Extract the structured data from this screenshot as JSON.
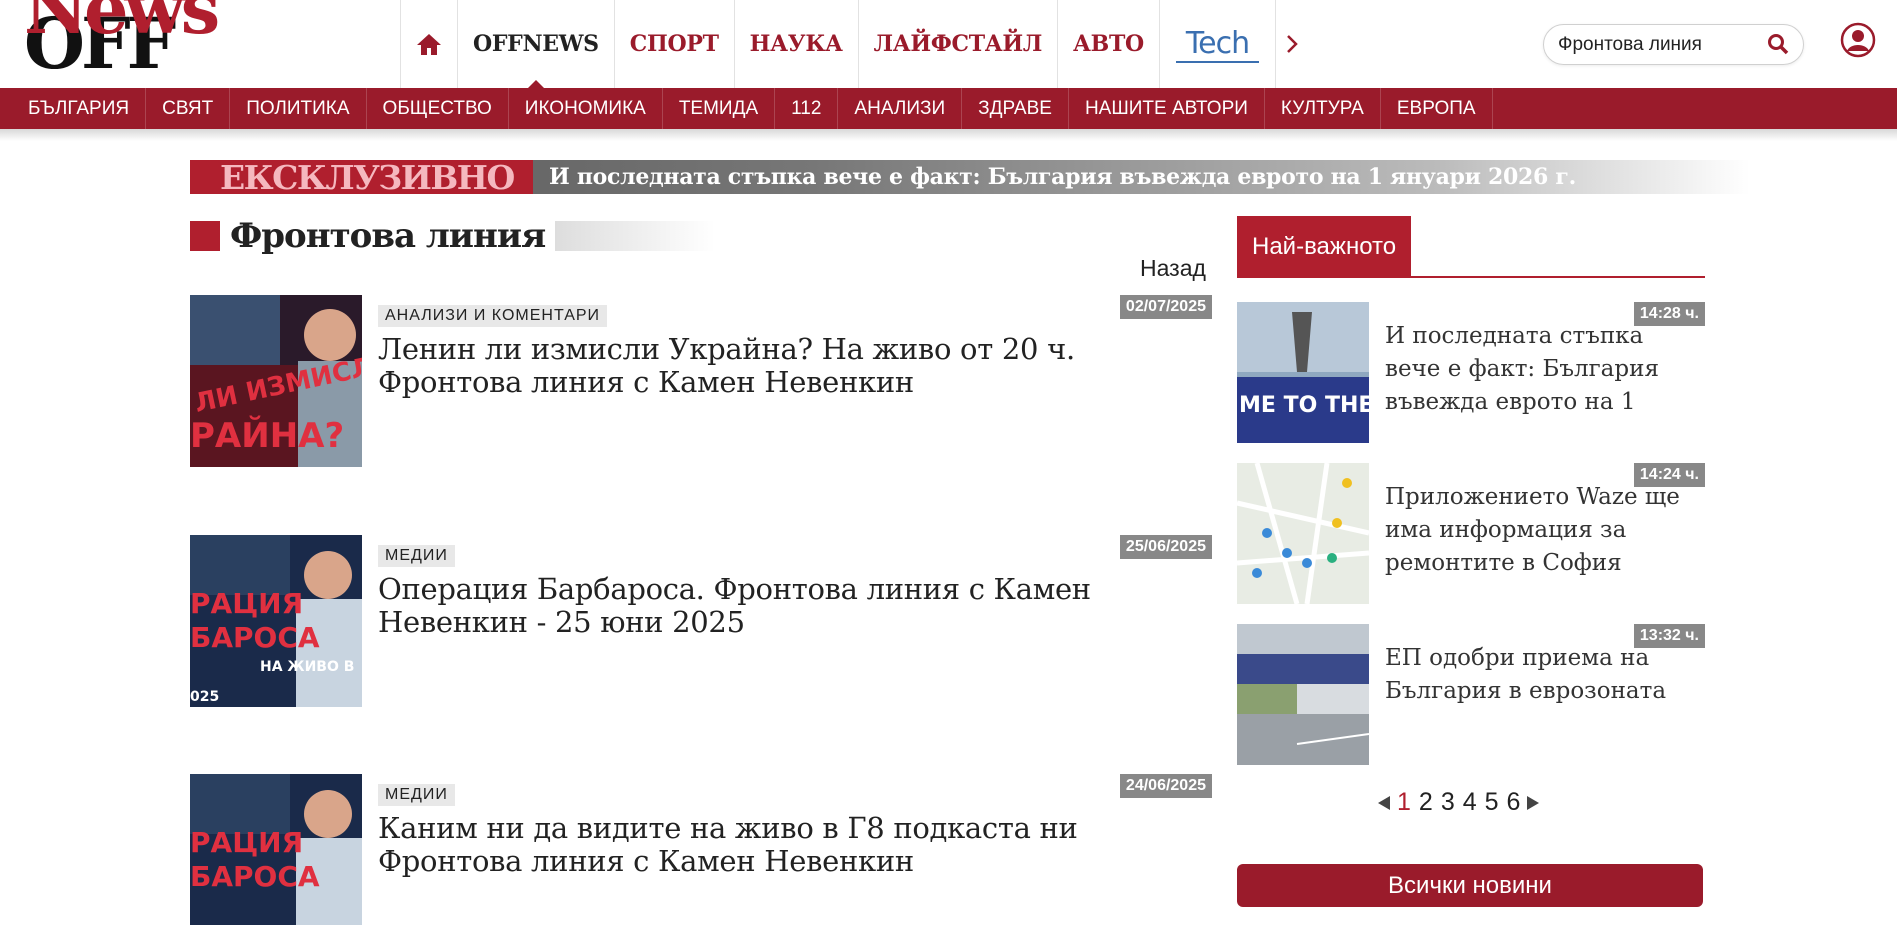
{
  "header": {
    "logo_off": "OFF",
    "logo_news": "News",
    "nav": [
      "OFFNEWS",
      "СПОРТ",
      "НАУКА",
      "ЛАЙФСТАЙЛ",
      "АВТО"
    ],
    "tech_label": "Tech",
    "search_value": "Фронтова линия",
    "accent": "#9a1b2b"
  },
  "subnav": [
    "БЪЛГАРИЯ",
    "СВЯТ",
    "ПОЛИТИКА",
    "ОБЩЕСТВО",
    "ИКОНОМИКА",
    "ТЕМИДА",
    "112",
    "АНАЛИЗИ",
    "ЗДРАВЕ",
    "НАШИТЕ АВТОРИ",
    "КУЛТУРА",
    "ЕВРОПА"
  ],
  "breaking": {
    "tag": "ЕКСКЛУЗИВНО",
    "headline": "И последната стъпка вече е факт: България въвежда еврото на 1 януари 2026 г."
  },
  "section": {
    "title": "Фронтова линия",
    "back": "Назад"
  },
  "articles": [
    {
      "category": "АНАЛИЗИ И КОМЕНТАРИ",
      "date": "02/07/2025",
      "title": "Ленин ли измисли Украйна? На живо от 20 ч. Фронтова линия с Камен Невенкин"
    },
    {
      "category": "МЕДИИ",
      "date": "25/06/2025",
      "title": "Операция Барбароса. Фронтова линия с Камен Невенкин - 25 юни 2025"
    },
    {
      "category": "МЕДИИ",
      "date": "24/06/2025",
      "title": "Каним ни да видите на живо в Г8 подкаста ни Фронтова линия с Камен Невенкин"
    }
  ],
  "sidebar": {
    "heading": "Най-важното",
    "news": [
      {
        "time": "14:28 ч.",
        "title": "И последната стъпка вече е факт: България въвежда еврото на 1"
      },
      {
        "time": "14:24 ч.",
        "title": "Приложението Waze ще има информация за ремонтите в София"
      },
      {
        "time": "13:32 ч.",
        "title": "ЕП одобри приема на България в еврозоната"
      }
    ],
    "pages": [
      "1",
      "2",
      "3",
      "4",
      "5",
      "6"
    ],
    "current_page": "1",
    "all_news": "Всички новини"
  }
}
